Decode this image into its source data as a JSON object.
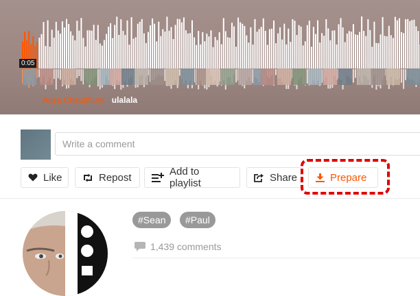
{
  "player": {
    "current_time": "0:05",
    "comment_user": "Aqsa Chaudhury",
    "comment_text": "ulalala",
    "played_fraction": 0.09
  },
  "comment_box": {
    "placeholder": "Write a comment"
  },
  "actions": {
    "like": "Like",
    "repost": "Repost",
    "add_to_playlist": "Add to playlist",
    "share": "Share",
    "prepare": "Prepare"
  },
  "tags": [
    "#Sean",
    "#Paul"
  ],
  "stats": {
    "comments": "1,439 comments"
  },
  "colors": {
    "accent": "#ff5500",
    "highlight": "#e00000",
    "tag_bg": "#999999"
  },
  "icons": [
    "heart-icon",
    "repost-icon",
    "add-to-playlist-icon",
    "share-icon",
    "download-icon",
    "comment-icon"
  ]
}
